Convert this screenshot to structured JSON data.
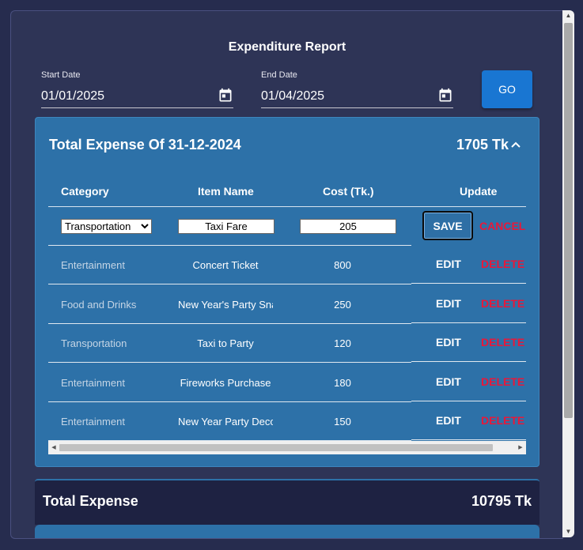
{
  "report": {
    "title": "Expenditure Report",
    "start_date": {
      "label": "Start Date",
      "value": "01/01/2025"
    },
    "end_date": {
      "label": "End Date",
      "value": "01/04/2025"
    },
    "go_label": "GO"
  },
  "day_card": {
    "title": "Total Expense Of 31-12-2024",
    "total": "1705 Tk",
    "columns": [
      "Category",
      "Item Name",
      "Cost (Tk.)",
      "Update"
    ],
    "edit_row": {
      "category": "Transportation",
      "item": "Taxi Fare",
      "cost": "205",
      "save_label": "SAVE",
      "cancel_label": "CANCEL"
    },
    "rows": [
      {
        "category": "Entertainment",
        "item": "Concert Ticket",
        "cost": "800"
      },
      {
        "category": "Food and Drinks",
        "item": "New Year's Party Snacks",
        "cost": "250"
      },
      {
        "category": "Transportation",
        "item": "Taxi to Party",
        "cost": "120"
      },
      {
        "category": "Entertainment",
        "item": "Fireworks Purchase",
        "cost": "180"
      },
      {
        "category": "Entertainment",
        "item": "New Year Party Decorations",
        "cost": "150"
      }
    ],
    "edit_label": "EDIT",
    "delete_label": "DELETE"
  },
  "grand_total": {
    "label": "Total Expense",
    "value": "10795 Tk"
  },
  "colors": {
    "card": "#2d71a8",
    "background": "#262c4e",
    "delete": "#e8183a",
    "go": "#1976d2"
  },
  "icons": {
    "calendar": "calendar-icon",
    "collapse": "chevron-up-icon"
  }
}
